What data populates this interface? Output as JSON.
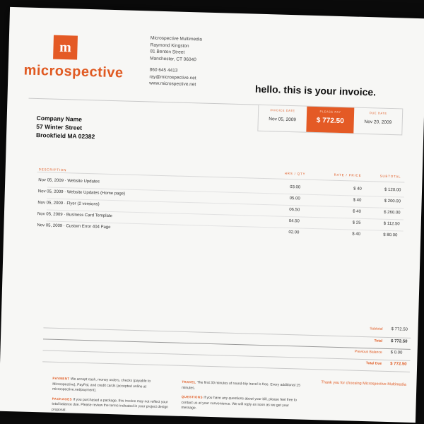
{
  "brand": {
    "logo_glyph": "m",
    "name": "microspective",
    "accent": "#e45a25"
  },
  "sender": {
    "company": "Microspective Multimedia",
    "person": "Raymond Kingston",
    "street": "81 Benton Street",
    "city": "Manchester, CT 06040",
    "phone": "860 645 4413",
    "email": "ray@microspective.net",
    "web": "www.microspective.net"
  },
  "headline": "hello. this is your invoice.",
  "summary": {
    "invoice_date_label": "invoice date",
    "invoice_date": "Nov 05, 2009",
    "amount_due_label": "please pay",
    "amount_due": "$ 772.50",
    "due_date_label": "due date",
    "due_date": "Nov 20, 2009"
  },
  "client": {
    "name": "Company Name",
    "street": "57 Winter Street",
    "city": "Brookfield MA 02382"
  },
  "columns": {
    "description": "description",
    "qty": "hrs / qty",
    "rate": "rate / price",
    "subtotal": "subtotal"
  },
  "items": [
    {
      "desc": "Nov 05, 2009 · Website Updates",
      "qty": "03.00",
      "rate": "$ 40",
      "subtotal": "$ 120.00"
    },
    {
      "desc": "Nov 05, 2009 · Website Updates (Home page)",
      "qty": "05.00",
      "rate": "$ 40",
      "subtotal": "$ 200.00"
    },
    {
      "desc": "Nov 05, 2009 · Flyer (2 versions)",
      "qty": "06.50",
      "rate": "$ 40",
      "subtotal": "$ 260.00"
    },
    {
      "desc": "Nov 05, 2009 · Business Card Template",
      "qty": "04.50",
      "rate": "$ 25",
      "subtotal": "$ 112.50"
    },
    {
      "desc": "Nov 05, 2009 · Custom Error 404 Page",
      "qty": "02.00",
      "rate": "$ 40",
      "subtotal": "$ 80.00"
    }
  ],
  "totals": {
    "subtotal_label": "Subtotal",
    "subtotal": "$ 772.50",
    "total_label": "Total",
    "total": "$ 772.50",
    "previous_label": "Previous Balance",
    "previous": "$ 0.00",
    "due_label": "Total Due",
    "due": "$ 772.50"
  },
  "footer": {
    "payment_label": "payment",
    "payment_text": "We accept cash, money orders, checks (payable to Microspective), PayPal, and credit cards (accepted online at microspective.net/payment).",
    "packages_label": "packages",
    "packages_text": "If you purchased a package, this invoice may not reflect your total balance due. Please review the terms indicated in your project design proposal.",
    "travel_label": "travel",
    "travel_text": "The first 30 minutes of round-trip travel is free. Every additional 15 minutes.",
    "questions_label": "questions",
    "questions_text": "If you have any questions about your bill, please feel free to contact us at your convenience. We will reply as soon as we get your message.",
    "thanks": "Thank you for choosing Microspective Multimedia"
  }
}
